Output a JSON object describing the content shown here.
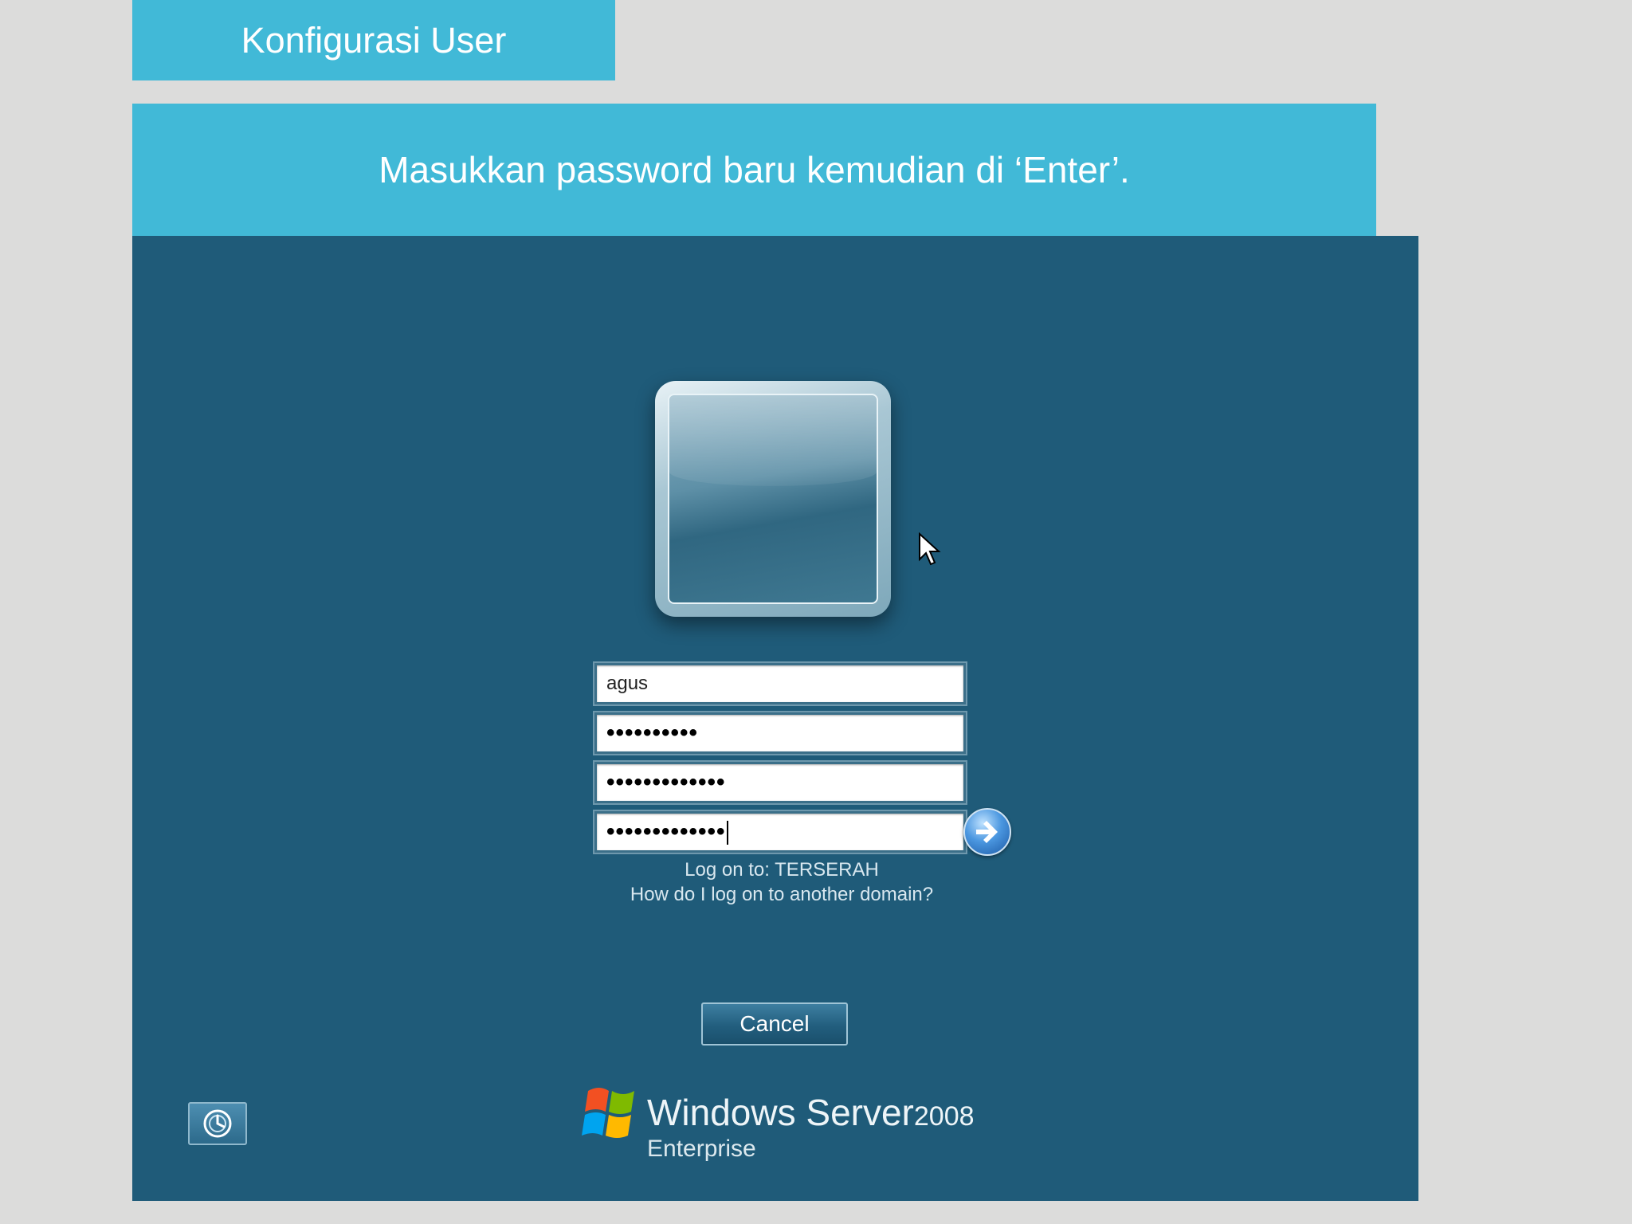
{
  "slide": {
    "title": "Konfigurasi User",
    "instruction": "Masukkan password baru kemudian di ‘Enter’."
  },
  "logon": {
    "username_value": "agus",
    "old_password_mask": "••••••••••",
    "new_password_mask": "•••••••••••••",
    "confirm_password_mask": "•••••••••••••",
    "logon_to": "Log on to: TERSERAH",
    "domain_help": "How do I log on to another domain?",
    "cancel_label": "Cancel",
    "submit_icon": "arrow-right-icon",
    "accessibility_icon": "ease-of-access-icon"
  },
  "brand": {
    "product": "Windows Server",
    "version": "2008",
    "edition": "Enterprise"
  },
  "colors": {
    "slide_accent": "#41b9d7",
    "screen_background": "#1f5b79",
    "page_background": "#dcdcdb"
  }
}
